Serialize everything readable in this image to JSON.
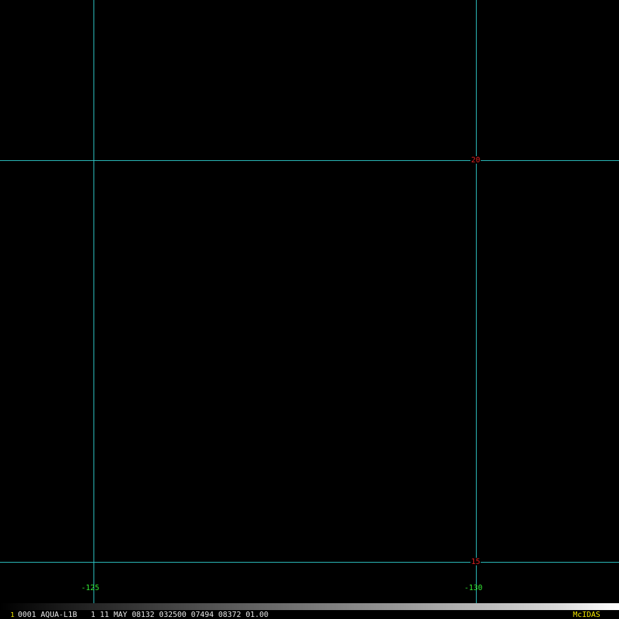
{
  "map": {
    "background": "#000000",
    "grid_color": "#2ec9c9",
    "latitudes": [
      {
        "label": "20",
        "value": 20
      },
      {
        "label": "15",
        "value": 15
      }
    ],
    "longitudes": [
      {
        "label": "-125",
        "value": -125
      },
      {
        "label": "-130",
        "value": -130
      }
    ]
  },
  "status": {
    "frame_number": "1",
    "info_line": "0001 AQUA-L1B   1 11 MAY 08132 032500 07494 08372 01.00",
    "brand": "McIDAS"
  }
}
